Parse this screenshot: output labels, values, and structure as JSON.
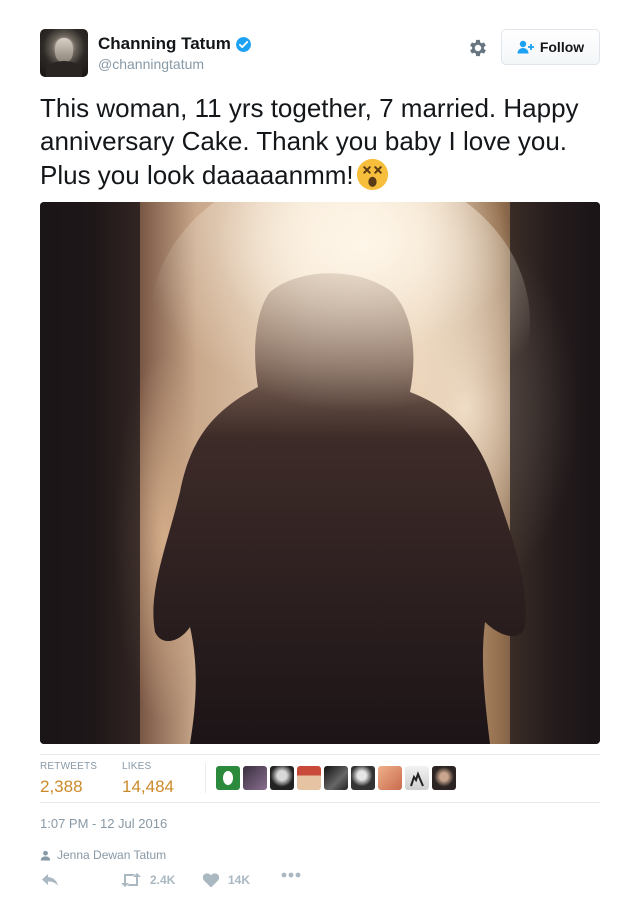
{
  "author": {
    "display_name": "Channing Tatum",
    "handle": "@channingtatum",
    "avatar_icon": "profile-photo",
    "verified_icon": "verified-badge-icon"
  },
  "header": {
    "settings_icon": "gear-icon",
    "follow_label": "Follow",
    "follow_icon": "add-user-icon"
  },
  "tweet": {
    "text": "This woman, 11 yrs together, 7 married. Happy anniversary Cake. Thank you baby I love you. Plus you look daaaaanmm!",
    "emoji_icon": "dizzy-face-emoji",
    "image_description": "silhouette-photo"
  },
  "stats": {
    "retweets_label": "RETWEETS",
    "retweets_value": "2,388",
    "likes_label": "LIKES",
    "likes_value": "14,484",
    "liker_avatars": [
      "avatar-1",
      "avatar-2",
      "avatar-3",
      "avatar-4",
      "avatar-5",
      "avatar-6",
      "avatar-7",
      "avatar-8",
      "avatar-9"
    ]
  },
  "meta": {
    "timestamp": "1:07 PM - 12 Jul 2016",
    "tagged_user": "Jenna Dewan Tatum",
    "tagged_icon": "person-icon"
  },
  "actions": {
    "reply_icon": "reply-icon",
    "retweet_icon": "retweet-icon",
    "retweet_count": "2.4K",
    "like_icon": "heart-icon",
    "like_count": "14K",
    "more_icon": "more-dots-icon"
  },
  "colors": {
    "stat_value": "#cc8a29",
    "muted": "#8899a6",
    "icon_muted": "#aab8c2",
    "verified": "#1da1f2"
  }
}
